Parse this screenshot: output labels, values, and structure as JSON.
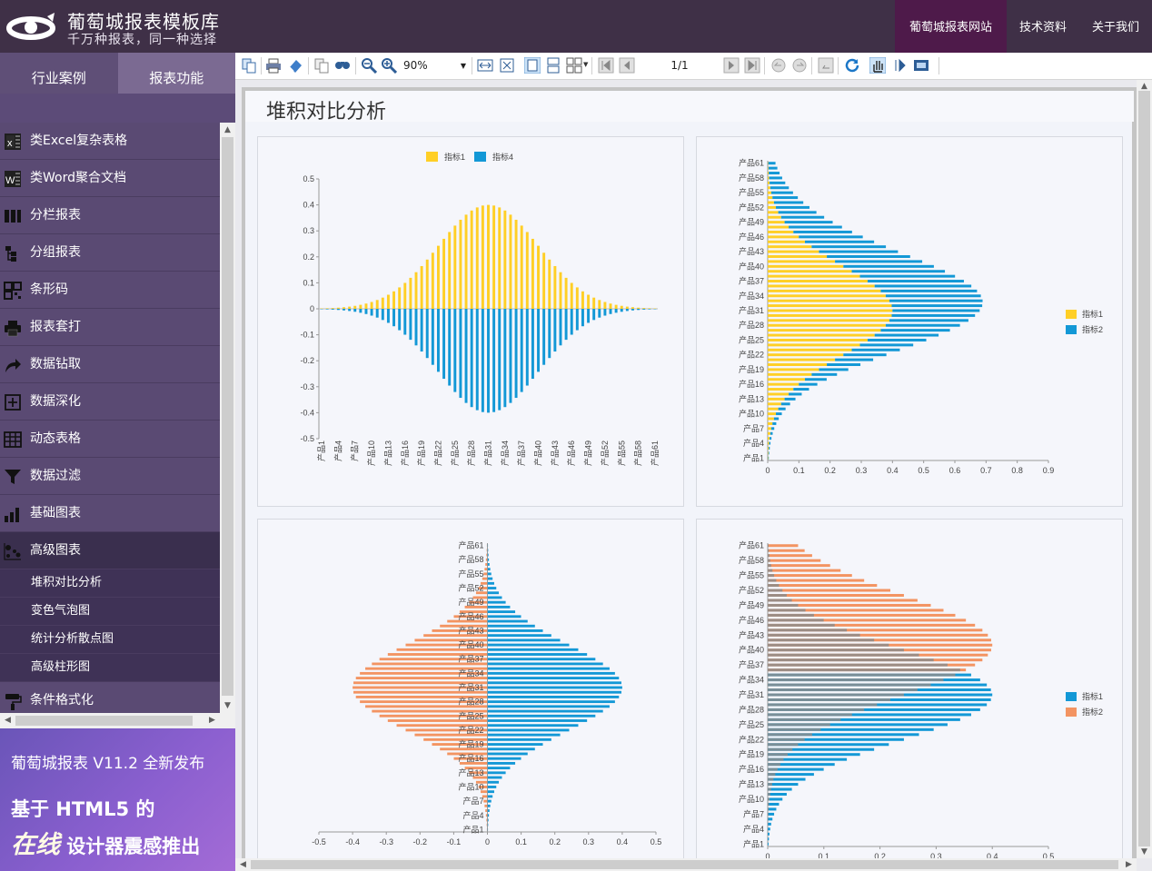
{
  "header": {
    "title": "葡萄城报表模板库",
    "subtitle": "千万种报表，同一种选择",
    "nav": [
      "葡萄城报表网站",
      "技术资料",
      "关于我们"
    ]
  },
  "sidebar": {
    "tabs": [
      "行业案例",
      "报表功能"
    ],
    "items": [
      {
        "label": "类Excel复杂表格",
        "icon": "excel-icon"
      },
      {
        "label": "类Word聚合文档",
        "icon": "word-icon"
      },
      {
        "label": "分栏报表",
        "icon": "columns-icon"
      },
      {
        "label": "分组报表",
        "icon": "tree-icon"
      },
      {
        "label": "条形码",
        "icon": "qrcode-icon"
      },
      {
        "label": "报表套打",
        "icon": "printer-icon"
      },
      {
        "label": "数据钻取",
        "icon": "share-arrow-icon"
      },
      {
        "label": "数据深化",
        "icon": "plus-square-icon"
      },
      {
        "label": "动态表格",
        "icon": "grid-icon"
      },
      {
        "label": "数据过滤",
        "icon": "filter-icon"
      },
      {
        "label": "基础图表",
        "icon": "bar-chart-icon"
      },
      {
        "label": "高级图表",
        "icon": "scatter-icon"
      }
    ],
    "subitems": [
      "堆积对比分析",
      "变色气泡图",
      "统计分析散点图",
      "高级柱形图"
    ],
    "after_items": [
      {
        "label": "条件格式化",
        "icon": "paint-roller-icon"
      }
    ],
    "promo": {
      "line1": "葡萄城报表 V11.2 全新发布",
      "line2": "基于 HTML5 的",
      "line3_em": "在线",
      "line3_rest": " 设计器震感推出"
    }
  },
  "toolbar": {
    "zoom": "90%",
    "page": "1/1"
  },
  "report": {
    "title": "堆积对比分析"
  },
  "colors": {
    "yellow": "#ffcf26",
    "blue": "#1398d6",
    "orange": "#f39462",
    "gray": "#7a7a7a"
  },
  "chart_data": [
    {
      "type": "bar",
      "orientation": "vertical",
      "stacked": true,
      "categories_count": 61,
      "category_prefix": "产品",
      "tick_labels": [
        "产品1",
        "产品4",
        "产品7",
        "产品10",
        "产品13",
        "产品16",
        "产品19",
        "产品22",
        "产品25",
        "产品28",
        "产品31",
        "产品34",
        "产品37",
        "产品40",
        "产品43",
        "产品46",
        "产品49",
        "产品52",
        "产品55",
        "产品58",
        "产品61"
      ],
      "series": [
        {
          "name": "指标1",
          "color": "#ffcf26",
          "distribution": {
            "center": 31,
            "sigma": 9,
            "peak": 0.4
          }
        },
        {
          "name": "指标4",
          "color": "#1398d6",
          "distribution": {
            "center": 31,
            "sigma": 9,
            "peak": -0.4
          }
        }
      ],
      "ylim": [
        -0.5,
        0.5
      ],
      "yticks": [
        -0.5,
        -0.4,
        -0.3,
        -0.2,
        -0.1,
        0,
        0.1,
        0.2,
        0.3,
        0.4,
        0.5
      ],
      "legend_position": "top"
    },
    {
      "type": "bar",
      "orientation": "horizontal",
      "stacked": true,
      "categories_count": 61,
      "category_prefix": "产品",
      "tick_labels": [
        "产品1",
        "产品4",
        "产品7",
        "产品10",
        "产品13",
        "产品16",
        "产品19",
        "产品22",
        "产品25",
        "产品28",
        "产品31",
        "产品34",
        "产品37",
        "产品40",
        "产品43",
        "产品46",
        "产品49",
        "产品52",
        "产品55",
        "产品58",
        "产品61"
      ],
      "series": [
        {
          "name": "指标1",
          "color": "#ffcf26",
          "distribution": {
            "center": 31,
            "sigma": 9,
            "peak": 0.4
          }
        },
        {
          "name": "指标2",
          "color": "#1398d6",
          "distribution": {
            "center": 36,
            "sigma": 11,
            "peak": 0.31
          }
        }
      ],
      "xlim": [
        0,
        0.9
      ],
      "xticks": [
        0,
        0.1,
        0.2,
        0.3,
        0.4,
        0.5,
        0.6,
        0.7,
        0.8,
        0.9
      ],
      "legend_position": "right"
    },
    {
      "type": "bar",
      "orientation": "horizontal",
      "stacked": false,
      "diverging": true,
      "categories_count": 61,
      "category_prefix": "产品",
      "tick_labels": [
        "产品1",
        "产品4",
        "产品7",
        "产品10",
        "产品13",
        "产品16",
        "产品19",
        "产品22",
        "产品25",
        "产品28",
        "产品31",
        "产品34",
        "产品37",
        "产品40",
        "产品43",
        "产品46",
        "产品49",
        "产品52",
        "产品55",
        "产品58",
        "产品61"
      ],
      "series": [
        {
          "color": "#f39462",
          "distribution": {
            "center": 31,
            "sigma": 9,
            "peak": -0.4
          }
        },
        {
          "color": "#1398d6",
          "distribution": {
            "center": 31,
            "sigma": 9,
            "peak": 0.4
          }
        }
      ],
      "xlim": [
        -0.5,
        0.5
      ],
      "xticks": [
        -0.5,
        -0.4,
        -0.3,
        -0.2,
        -0.1,
        0,
        0.1,
        0.2,
        0.3,
        0.4,
        0.5
      ]
    },
    {
      "type": "bar",
      "orientation": "horizontal",
      "stacked": false,
      "overlay": true,
      "categories_count": 61,
      "category_prefix": "产品",
      "tick_labels": [
        "产品1",
        "产品4",
        "产品7",
        "产品10",
        "产品13",
        "产品16",
        "产品19",
        "产品22",
        "产品25",
        "产品28",
        "产品31",
        "产品34",
        "产品37",
        "产品40",
        "产品43",
        "产品46",
        "产品49",
        "产品52",
        "产品55",
        "产品58",
        "产品61"
      ],
      "series": [
        {
          "name": "指标1",
          "color": "#1398d6",
          "distribution": {
            "center": 31,
            "sigma": 9,
            "peak": 0.4
          }
        },
        {
          "name": "指标2",
          "color": "#f39462",
          "distribution": {
            "center": 41,
            "sigma": 10,
            "peak": 0.4
          }
        }
      ],
      "xlim": [
        0,
        0.5
      ],
      "xticks": [
        0,
        0.1,
        0.2,
        0.3,
        0.4,
        0.5
      ],
      "legend_position": "right"
    }
  ]
}
